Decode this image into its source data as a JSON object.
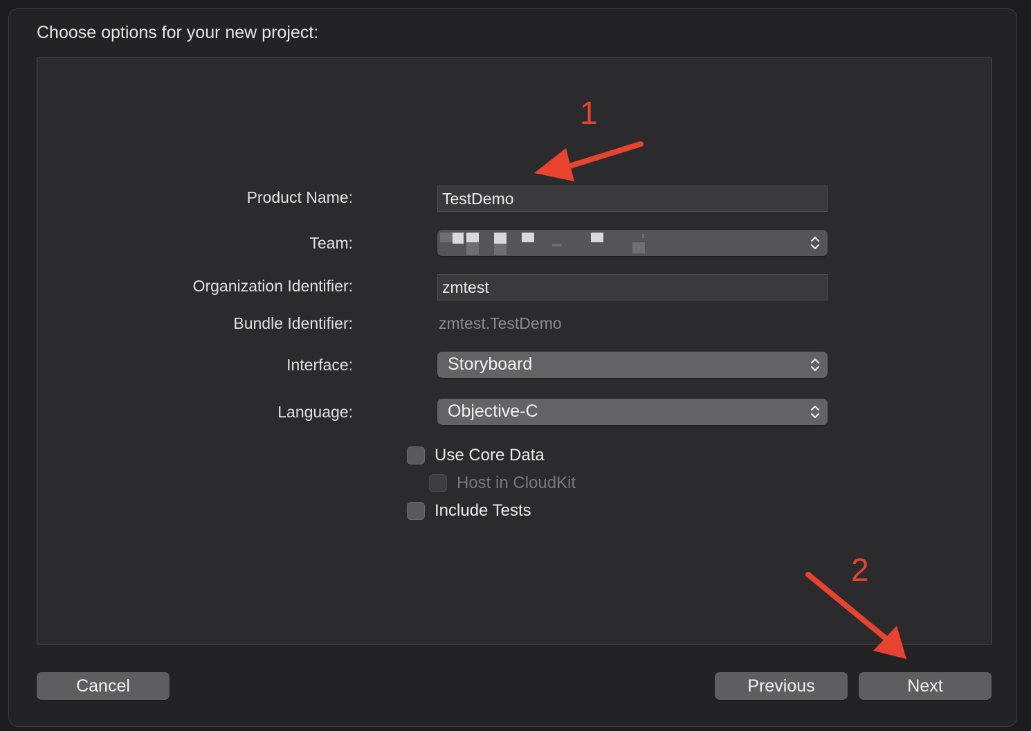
{
  "sheet": {
    "title": "Choose options for your new project:"
  },
  "form": {
    "product_name": {
      "label": "Product Name:",
      "value": "TestDemo"
    },
    "team": {
      "label": "Team:",
      "value": ""
    },
    "organization_identifier": {
      "label": "Organization Identifier:",
      "value": "zmtest"
    },
    "bundle_identifier": {
      "label": "Bundle Identifier:",
      "value": "zmtest.TestDemo"
    },
    "interface": {
      "label": "Interface:",
      "value": "Storyboard"
    },
    "language": {
      "label": "Language:",
      "value": "Objective-C"
    },
    "use_core_data": {
      "label": "Use Core Data",
      "checked": false
    },
    "host_in_cloudkit": {
      "label": "Host in CloudKit",
      "checked": false,
      "enabled": false
    },
    "include_tests": {
      "label": "Include Tests",
      "checked": false
    }
  },
  "buttons": {
    "cancel": "Cancel",
    "previous": "Previous",
    "next": "Next"
  },
  "annotations": {
    "marker_1": "1",
    "marker_2": "2",
    "color": "#e8432f"
  },
  "colors": {
    "window_bg": "#232326",
    "panel_bg": "#2b2b2d",
    "popup_bg": "#636366"
  }
}
